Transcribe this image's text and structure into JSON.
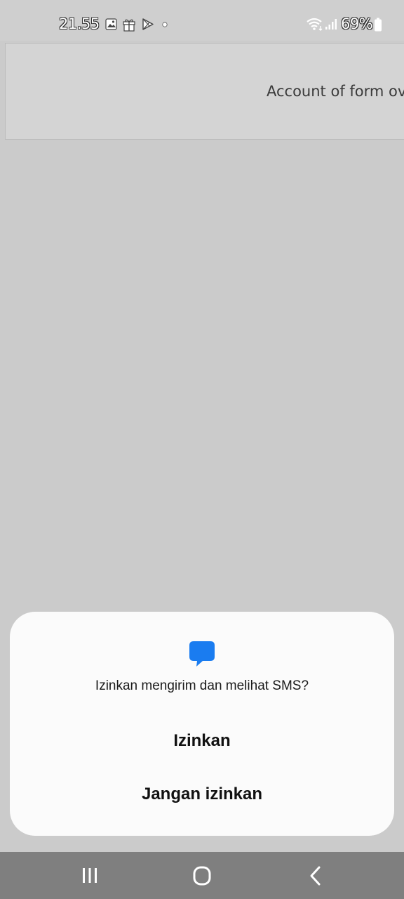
{
  "status_bar": {
    "time": "21.55",
    "battery_percent": "69%",
    "icons": [
      "image-icon",
      "gift-icon",
      "play-store-icon",
      "dot-icon",
      "wifi-icon",
      "signal-icon",
      "battery-icon"
    ]
  },
  "app": {
    "card_text": "Account of form ov"
  },
  "permission_dialog": {
    "icon": "sms-message-icon",
    "icon_color": "#1a7cf0",
    "question": "Izinkan mengirim dan melihat SMS?",
    "allow_label": "Izinkan",
    "deny_label": "Jangan izinkan"
  },
  "nav_bar": {
    "buttons": [
      "recent-apps-icon",
      "home-icon",
      "back-icon"
    ]
  }
}
